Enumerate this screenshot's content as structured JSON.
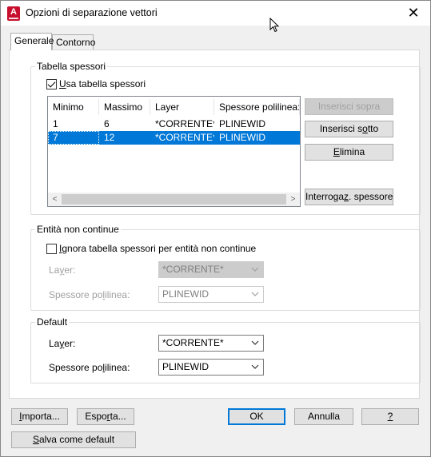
{
  "window": {
    "title": "Opzioni di separazione vettori",
    "app_icon_letter": "A",
    "close_glyph": "✕"
  },
  "tabs": [
    {
      "label": "Generale",
      "active": true
    },
    {
      "label": "Contorno",
      "active": false
    }
  ],
  "tabella_spessori": {
    "group_label": "Tabella spessori",
    "use_checkbox": {
      "label_prefix": "",
      "label_mnemonic": "U",
      "label_rest": "sa tabella spessori",
      "checked": true
    },
    "columns": [
      "Minimo",
      "Massimo",
      "Layer",
      "Spessore polilinea:"
    ],
    "rows": [
      {
        "minimo": "1",
        "massimo": "6",
        "layer": "*CORRENTE*",
        "spessore": "PLINEWID",
        "selected": false
      },
      {
        "minimo": "7",
        "massimo": "12",
        "layer": "*CORRENTE*",
        "spessore": "PLINEWID",
        "selected": true
      }
    ],
    "scroll_left": "<",
    "scroll_right": ">",
    "buttons": {
      "inserisci_sopra": {
        "label": "Inserisci sopra",
        "enabled": false
      },
      "inserisci_sotto": {
        "prefix": "Inserisci s",
        "mnemonic": "o",
        "rest": "tto",
        "enabled": true
      },
      "elimina": {
        "prefix": "",
        "mnemonic": "E",
        "rest": "limina",
        "enabled": true
      },
      "interrogaz": {
        "prefix": "Interroga",
        "mnemonic": "z",
        "rest": ". spessore <",
        "enabled": true
      }
    }
  },
  "entita_non_continue": {
    "group_label": "Entità non continue",
    "ignore_checkbox": {
      "prefix": "",
      "mnemonic": "I",
      "rest": "gnora tabella spessori per entità non continue",
      "checked": false
    },
    "layer_label": {
      "prefix": "La",
      "mnemonic": "y",
      "rest": "er:"
    },
    "layer_value": "*CORRENTE*",
    "spessore_label": {
      "prefix": "Spessore po",
      "mnemonic": "l",
      "rest": "ilinea:"
    },
    "spessore_value": "PLINEWID"
  },
  "default_group": {
    "group_label": "Default",
    "layer_label": {
      "prefix": "La",
      "mnemonic": "y",
      "rest": "er:"
    },
    "layer_value": "*CORRENTE*",
    "spessore_label": {
      "prefix": "Spessore po",
      "mnemonic": "l",
      "rest": "ilinea:"
    },
    "spessore_value": "PLINEWID"
  },
  "bottom_buttons": {
    "importa": {
      "prefix": "",
      "mnemonic": "I",
      "rest": "mporta..."
    },
    "esporta": {
      "prefix": "Espo",
      "mnemonic": "r",
      "rest": "ta..."
    },
    "ok": {
      "label": "OK"
    },
    "annulla": {
      "label": "Annulla"
    },
    "help": {
      "prefix": "",
      "mnemonic": "?",
      "rest": ""
    },
    "salva_default": {
      "prefix": "",
      "mnemonic": "S",
      "rest": "alva come default"
    }
  },
  "colors": {
    "selection": "#0078d7",
    "app_icon": "#c8102e"
  }
}
